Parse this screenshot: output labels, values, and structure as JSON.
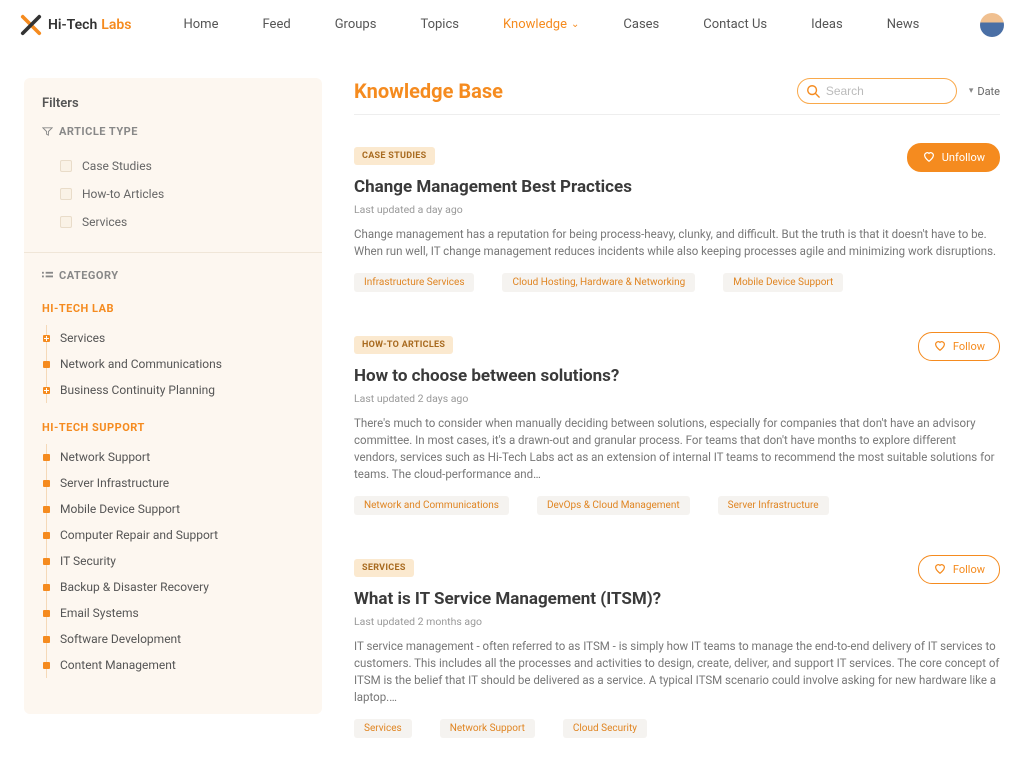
{
  "brand": {
    "name1": "Hi-Tech",
    "name2": "Labs"
  },
  "nav": [
    {
      "label": "Home",
      "active": false
    },
    {
      "label": "Feed",
      "active": false
    },
    {
      "label": "Groups",
      "active": false
    },
    {
      "label": "Topics",
      "active": false
    },
    {
      "label": "Knowledge",
      "active": true,
      "dropdown": true
    },
    {
      "label": "Cases",
      "active": false
    },
    {
      "label": "Contact Us",
      "active": false
    },
    {
      "label": "Ideas",
      "active": false
    },
    {
      "label": "News",
      "active": false
    }
  ],
  "sidebar": {
    "heading": "Filters",
    "articleType": {
      "label": "ARTICLE TYPE",
      "items": [
        "Case Studies",
        "How-to Articles",
        "Services"
      ]
    },
    "category": {
      "label": "CATEGORY",
      "groups": [
        {
          "title": "HI-TECH LAB",
          "items": [
            {
              "label": "Services",
              "expandable": true
            },
            {
              "label": "Network and Communications",
              "expandable": false
            },
            {
              "label": "Business Continuity Planning",
              "expandable": true
            }
          ]
        },
        {
          "title": "HI-TECH SUPPORT",
          "items": [
            {
              "label": "Network Support",
              "expandable": false
            },
            {
              "label": "Server Infrastructure",
              "expandable": false
            },
            {
              "label": "Mobile Device Support",
              "expandable": false
            },
            {
              "label": "Computer Repair and Support",
              "expandable": false
            },
            {
              "label": "IT Security",
              "expandable": false
            },
            {
              "label": "Backup & Disaster Recovery",
              "expandable": false
            },
            {
              "label": "Email Systems",
              "expandable": false
            },
            {
              "label": "Software Development",
              "expandable": false
            },
            {
              "label": "Content Management",
              "expandable": false
            }
          ]
        }
      ]
    }
  },
  "main": {
    "title": "Knowledge Base",
    "search_placeholder": "Search",
    "sort_label": "Date"
  },
  "articles": [
    {
      "type": "CASE STUDIES",
      "follow_label": "Unfollow",
      "following": true,
      "title": "Change Management Best Practices",
      "meta": "Last updated a day ago",
      "desc": "Change management has a reputation for being process-heavy, clunky, and difficult. But the truth is that it doesn't have to be. When run well, IT change management reduces incidents while also keeping processes agile and minimizing work disruptions.",
      "tags": [
        "Infrastructure Services",
        "Cloud Hosting, Hardware & Networking",
        "Mobile Device Support"
      ]
    },
    {
      "type": "HOW-TO ARTICLES",
      "follow_label": "Follow",
      "following": false,
      "title": "How to choose between solutions?",
      "meta": "Last updated 2 days ago",
      "desc": "There's much to consider when manually deciding between solutions, especially for companies that don't have an advisory committee. In most cases, it's a drawn-out and granular process. For teams that don't have months to explore different vendors, services such as Hi-Tech Labs act as an extension of internal IT teams to recommend the most suitable solutions for teams. The cloud-performance and…",
      "tags": [
        "Network and Communications",
        "DevOps & Cloud Management",
        "Server Infrastructure"
      ]
    },
    {
      "type": "SERVICES",
      "follow_label": "Follow",
      "following": false,
      "title": "What is IT Service Management (ITSM)?",
      "meta": "Last updated 2 months ago",
      "desc": "IT service management - often referred to as ITSM - is simply how IT teams to manage the end-to-end delivery of IT services to customers. This includes all the processes and activities to design, create, deliver, and support IT services. The core concept of ITSM is the belief that IT should be delivered as a service. A typical ITSM scenario could involve asking for new hardware like a laptop.…",
      "tags": [
        "Services",
        "Network Support",
        "Cloud Security"
      ]
    }
  ]
}
